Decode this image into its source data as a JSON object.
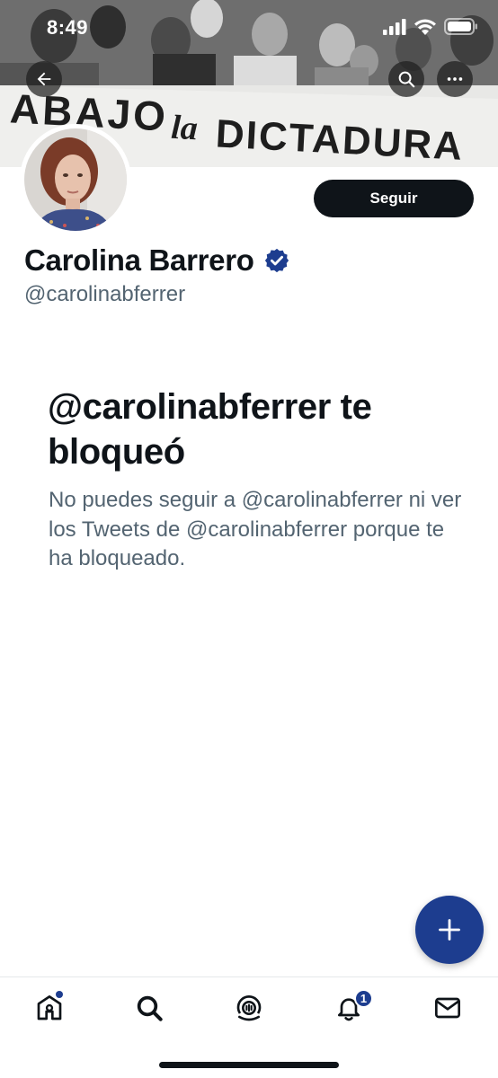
{
  "status_bar": {
    "time": "8:49"
  },
  "banner": {
    "protest_sign_text": "ABAJO la DICTADURA"
  },
  "header": {
    "back_icon": "arrow-left-icon",
    "search_icon": "search-icon",
    "more_icon": "more-horizontal-icon"
  },
  "profile": {
    "name": "Carolina Barrero",
    "handle": "@carolinabferrer",
    "verified": true,
    "follow_label": "Seguir"
  },
  "blocked": {
    "title": "@carolinabferrer te bloqueó",
    "body": "No puedes seguir a @carolinabferrer ni ver los Tweets de @carolinabferrer porque te ha bloqueado."
  },
  "fab": {
    "icon": "plus-icon"
  },
  "bottom_nav": {
    "items": [
      {
        "name": "home",
        "icon": "home-icon",
        "has_dot": true
      },
      {
        "name": "search",
        "icon": "search-icon"
      },
      {
        "name": "spaces",
        "icon": "spaces-icon"
      },
      {
        "name": "notifications",
        "icon": "bell-icon",
        "badge": "1"
      },
      {
        "name": "messages",
        "icon": "mail-icon"
      }
    ]
  },
  "colors": {
    "accent": "#1d3d8f",
    "text_primary": "#0f1419",
    "text_secondary": "#536471"
  }
}
